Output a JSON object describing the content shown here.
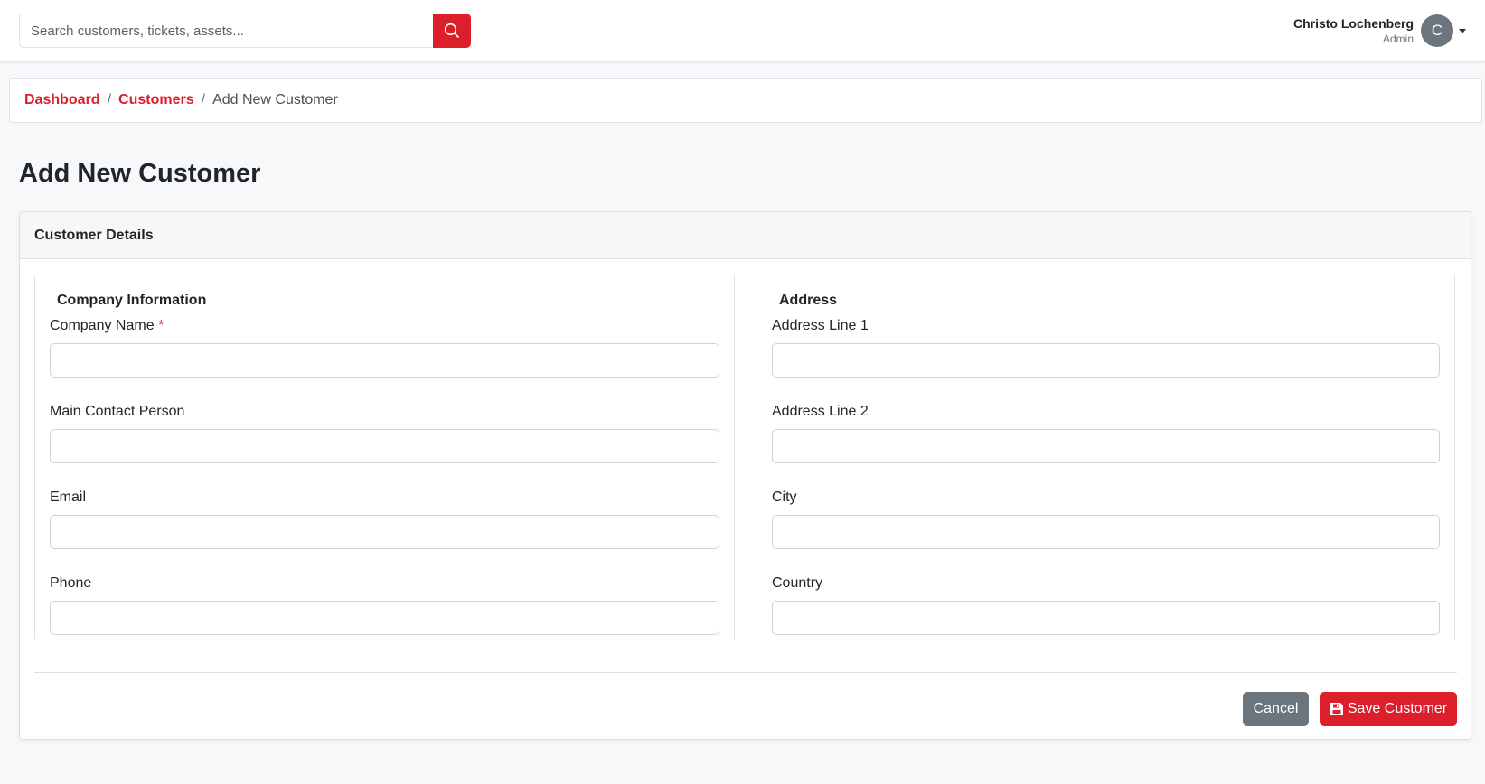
{
  "header": {
    "search_placeholder": "Search customers, tickets, assets...",
    "search_icon": "search-icon",
    "user": {
      "name": "Christo Lochenberg",
      "role": "Admin",
      "avatar_initial": "C"
    }
  },
  "breadcrumb": {
    "items": [
      "Dashboard",
      "Customers"
    ],
    "separator": "/",
    "current": "Add New Customer"
  },
  "page": {
    "title": "Add New Customer"
  },
  "card": {
    "title": "Customer Details",
    "company_section": {
      "legend": "Company Information",
      "fields": [
        {
          "label": "Company Name",
          "required_marker": "*",
          "value": ""
        },
        {
          "label": "Main Contact Person",
          "value": ""
        },
        {
          "label": "Email",
          "value": ""
        },
        {
          "label": "Phone",
          "value": ""
        }
      ]
    },
    "address_section": {
      "legend": "Address",
      "fields": [
        {
          "label": "Address Line 1",
          "value": ""
        },
        {
          "label": "Address Line 2",
          "value": ""
        },
        {
          "label": "City",
          "value": ""
        },
        {
          "label": "Country",
          "value": ""
        }
      ]
    },
    "actions": {
      "cancel_label": "Cancel",
      "save_label": "Save Customer",
      "save_icon": "save-icon"
    }
  },
  "colors": {
    "accent": "#dc1f2b",
    "secondary": "#6c757d"
  }
}
